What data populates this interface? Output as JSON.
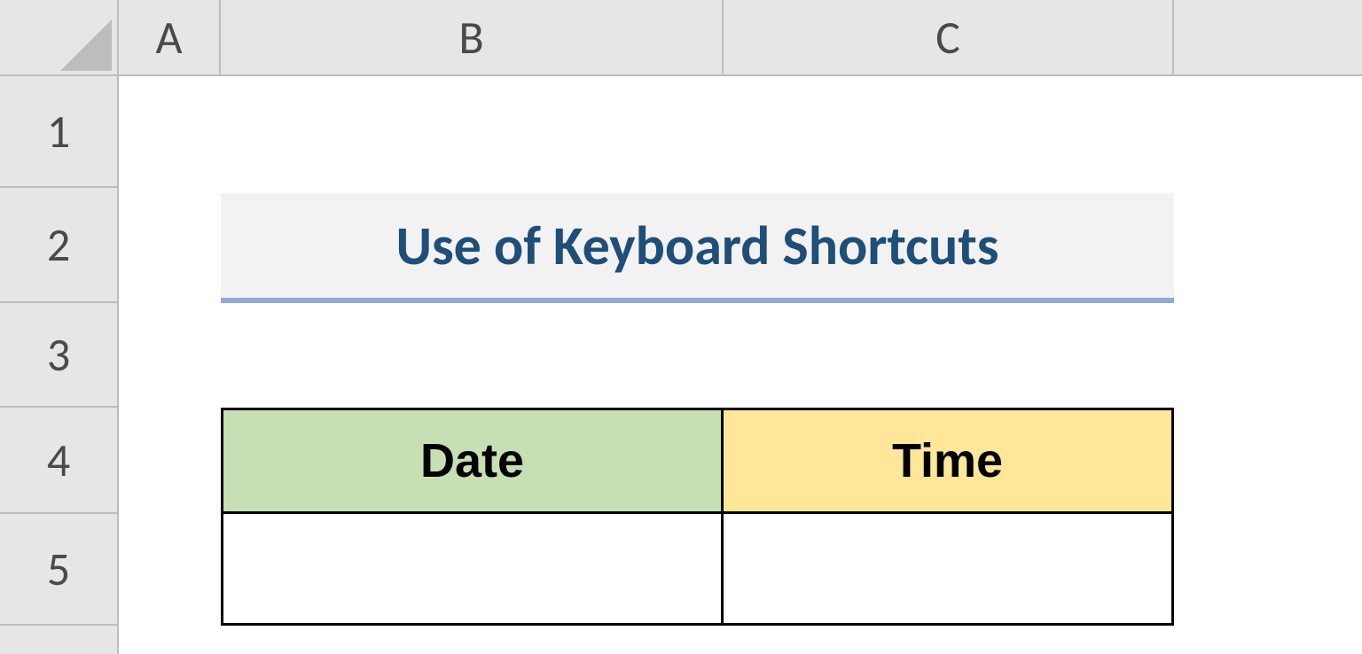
{
  "columns": {
    "A": "A",
    "B": "B",
    "C": "C"
  },
  "rows": {
    "1": "1",
    "2": "2",
    "3": "3",
    "4": "4",
    "5": "5"
  },
  "title": "Use of Keyboard Shortcuts",
  "table": {
    "headers": {
      "date": "Date",
      "time": "Time"
    },
    "row1": {
      "date": "",
      "time": ""
    }
  },
  "colors": {
    "header_bg": "#e6e6e6",
    "title_bg": "#f2f2f2",
    "title_text": "#1f4e78",
    "title_underline": "#8ea9db",
    "date_header_bg": "#c6e0b4",
    "time_header_bg": "#ffe699"
  }
}
